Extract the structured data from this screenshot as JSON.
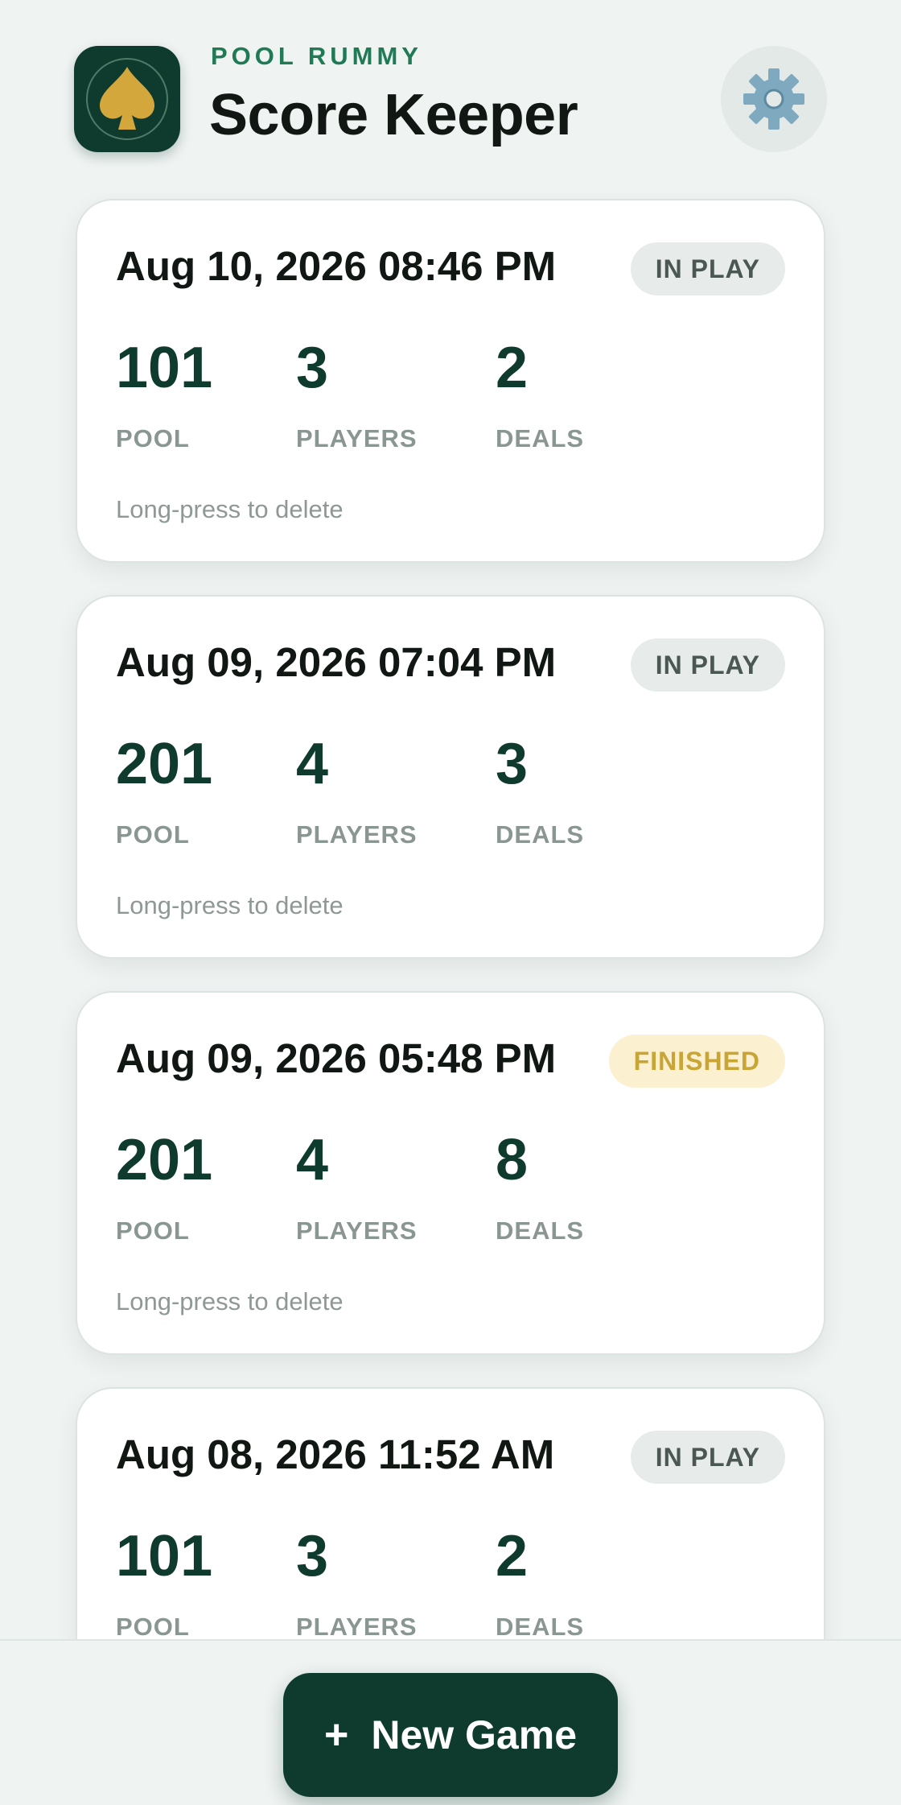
{
  "header": {
    "subtitle": "POOL RUMMY",
    "title": "Score Keeper",
    "logo_icon": "spade-icon",
    "settings_icon": "gear-icon"
  },
  "colors": {
    "background": "#eff3f2",
    "primary": "#0f3b2e",
    "accent_gold": "#d4a73c",
    "subtitle_green": "#1f7a55",
    "finished_badge_bg": "#fbf0cf",
    "finished_badge_text": "#c9a536",
    "inplay_badge_bg": "#e7ecea",
    "inplay_badge_text": "#4b5753"
  },
  "games": [
    {
      "date": "Aug 10, 2026 08:46 PM",
      "status": "IN PLAY",
      "pool": "101",
      "pool_label": "POOL",
      "players": "3",
      "players_label": "PLAYERS",
      "deals": "2",
      "deals_label": "DEALS",
      "hint": "Long-press to delete"
    },
    {
      "date": "Aug 09, 2026 07:04 PM",
      "status": "IN PLAY",
      "pool": "201",
      "pool_label": "POOL",
      "players": "4",
      "players_label": "PLAYERS",
      "deals": "3",
      "deals_label": "DEALS",
      "hint": "Long-press to delete"
    },
    {
      "date": "Aug 09, 2026 05:48 PM",
      "status": "FINISHED",
      "pool": "201",
      "pool_label": "POOL",
      "players": "4",
      "players_label": "PLAYERS",
      "deals": "8",
      "deals_label": "DEALS",
      "hint": "Long-press to delete"
    },
    {
      "date": "Aug 08, 2026 11:52 AM",
      "status": "IN PLAY",
      "pool": "101",
      "pool_label": "POOL",
      "players": "3",
      "players_label": "PLAYERS",
      "deals": "2",
      "deals_label": "DEALS",
      "hint": ""
    }
  ],
  "footer": {
    "plus_symbol": "+",
    "new_game_label": "New Game"
  }
}
